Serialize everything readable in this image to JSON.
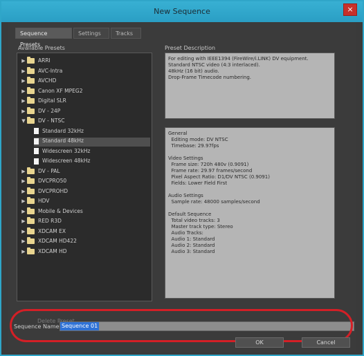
{
  "window": {
    "title": "New Sequence",
    "close_label": "×"
  },
  "tabs": [
    {
      "label": "Sequence Presets",
      "active": true
    },
    {
      "label": "Settings",
      "active": false
    },
    {
      "label": "Tracks",
      "active": false
    }
  ],
  "available_presets": {
    "label": "Available Presets",
    "items": [
      {
        "label": "ARRI",
        "type": "folder",
        "expanded": false,
        "indent": 0
      },
      {
        "label": "AVC-Intra",
        "type": "folder",
        "expanded": false,
        "indent": 0
      },
      {
        "label": "AVCHD",
        "type": "folder",
        "expanded": false,
        "indent": 0
      },
      {
        "label": "Canon XF MPEG2",
        "type": "folder",
        "expanded": false,
        "indent": 0
      },
      {
        "label": "Digital SLR",
        "type": "folder",
        "expanded": false,
        "indent": 0
      },
      {
        "label": "DV - 24P",
        "type": "folder",
        "expanded": false,
        "indent": 0
      },
      {
        "label": "DV - NTSC",
        "type": "folder",
        "expanded": true,
        "indent": 0
      },
      {
        "label": "Standard 32kHz",
        "type": "file",
        "indent": 1
      },
      {
        "label": "Standard 48kHz",
        "type": "file",
        "indent": 1,
        "selected": true
      },
      {
        "label": "Widescreen 32kHz",
        "type": "file",
        "indent": 1
      },
      {
        "label": "Widescreen 48kHz",
        "type": "file",
        "indent": 1
      },
      {
        "label": "DV - PAL",
        "type": "folder",
        "expanded": false,
        "indent": 0
      },
      {
        "label": "DVCPRO50",
        "type": "folder",
        "expanded": false,
        "indent": 0
      },
      {
        "label": "DVCPROHD",
        "type": "folder",
        "expanded": false,
        "indent": 0
      },
      {
        "label": "HDV",
        "type": "folder",
        "expanded": false,
        "indent": 0
      },
      {
        "label": "Mobile & Devices",
        "type": "folder",
        "expanded": false,
        "indent": 0
      },
      {
        "label": "RED R3D",
        "type": "folder",
        "expanded": false,
        "indent": 0
      },
      {
        "label": "XDCAM EX",
        "type": "folder",
        "expanded": false,
        "indent": 0
      },
      {
        "label": "XDCAM HD422",
        "type": "folder",
        "expanded": false,
        "indent": 0
      },
      {
        "label": "XDCAM HD",
        "type": "folder",
        "expanded": false,
        "indent": 0
      }
    ]
  },
  "preset_description": {
    "label": "Preset Description",
    "summary": "For editing with IEEE1394 (FireWire/i.LINK) DV equipment.\nStandard NTSC video (4:3 interlaced).\n48kHz (16 bit) audio.\nDrop-Frame Timecode numbering.",
    "details": "General\n  Editing mode: DV NTSC\n  Timebase: 29.97fps\n\nVideo Settings\n  Frame size: 720h 480v (0.9091)\n  Frame rate: 29.97 frames/second\n  Pixel Aspect Ratio: D1/DV NTSC (0.9091)\n  Fields: Lower Field First\n\nAudio Settings\n  Sample rate: 48000 samples/second\n\nDefault Sequence\n  Total video tracks: 3\n  Master track type: Stereo\n  Audio Tracks:\n  Audio 1: Standard\n  Audio 2: Standard\n  Audio 3: Standard"
  },
  "delete_preset_label": "Delete Preset",
  "sequence_name": {
    "label": "Sequence Name:",
    "value": "Sequence 01"
  },
  "buttons": {
    "ok": "OK",
    "cancel": "Cancel"
  },
  "colors": {
    "title_bar": "#2fa6c9",
    "dialog_bg": "#3b3b3b",
    "highlight": "#d41f26",
    "selection": "#2f72d6"
  }
}
